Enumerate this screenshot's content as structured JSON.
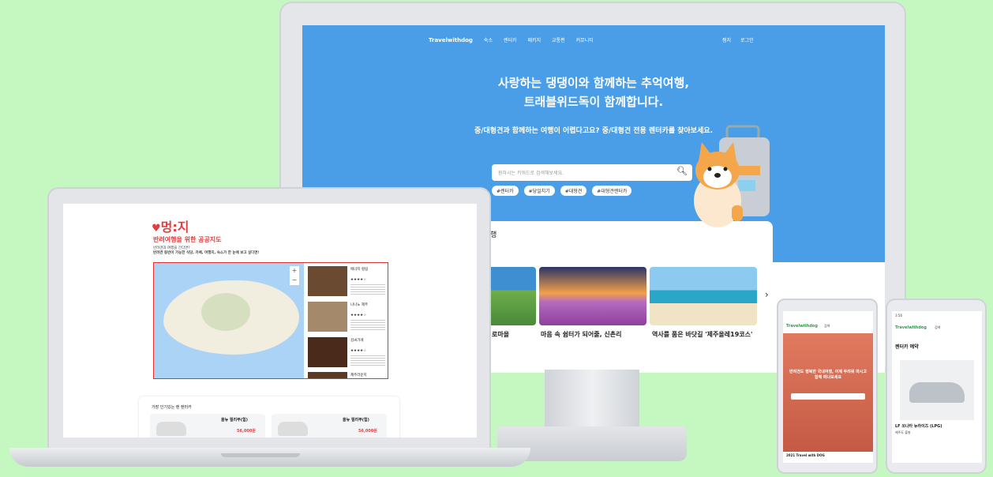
{
  "desktop": {
    "nav": {
      "brand": "Travelwithdog",
      "items": [
        "숙소",
        "렌터카",
        "패키지",
        "교통편",
        "커뮤니티"
      ],
      "right": [
        "찜지",
        "로그인"
      ]
    },
    "hero": {
      "line1": "사랑하는 댕댕이와 함께하는 추억여행,",
      "line2": "트래블위드독이 함께합니다.",
      "sub": "중/대형견과 함께하는 여행이 어렵다고요? 중/대형견 전용 렌터카를 찾아보세요.",
      "search_placeholder": "원하시는 키워드로 검색해보세요.",
      "tags": [
        "#렌터카",
        "#당일치기",
        "#대형견",
        "#대형견렌터카"
      ]
    },
    "section_title": "행",
    "cards": [
      "로마을",
      "마음 속 쉼터가 되어줄, 신촌리",
      "역사를 품은 바닷길 '제주올레19코스'"
    ],
    "colors": {
      "hero": "#4a9ee8",
      "accent": "#e43d3d",
      "brand_green": "#2c9e4a"
    }
  },
  "laptop": {
    "logo": "멍:지",
    "subtitle": "반려여행을 위한 공공지도",
    "desc1": "반려견과 여행을 간다면?",
    "desc2": "반려견 동반이 가능한 식당, 카페, 여행지, 숙소가 한 눈에 보고 싶다면!",
    "listings": [
      {
        "name": "에너지 힐링",
        "stars": "★★★★☆"
      },
      {
        "name": "나나노 제주",
        "stars": "★★★★☆"
      },
      {
        "name": "김씨가게",
        "stars": "★★★★☆"
      },
      {
        "name": "제주라운지",
        "stars": "★★★★☆"
      }
    ],
    "rental_title": "가장 인기있는 렌 렌터카",
    "rental_cars": [
      {
        "name": "올뉴 릴리부(힘)",
        "price": "56,000원"
      },
      {
        "name": "올뉴 릴리부(힘)",
        "price": "56,000원"
      }
    ]
  },
  "tablet": {
    "brand": "Travelwithdog",
    "search": "검색",
    "headline": "반려견도 행복한 국내여행, 이제 두려워 마시고 함께 떠나보세요",
    "footer": "2021 Travel with DOG"
  },
  "phone": {
    "time": "3:56",
    "brand": "Travelwithdog",
    "search": "검색",
    "heading": "렌터카 예약",
    "car": "LF 쏘나타 뉴라이즈 (LPG)",
    "car_sub": "제주도 출발"
  }
}
